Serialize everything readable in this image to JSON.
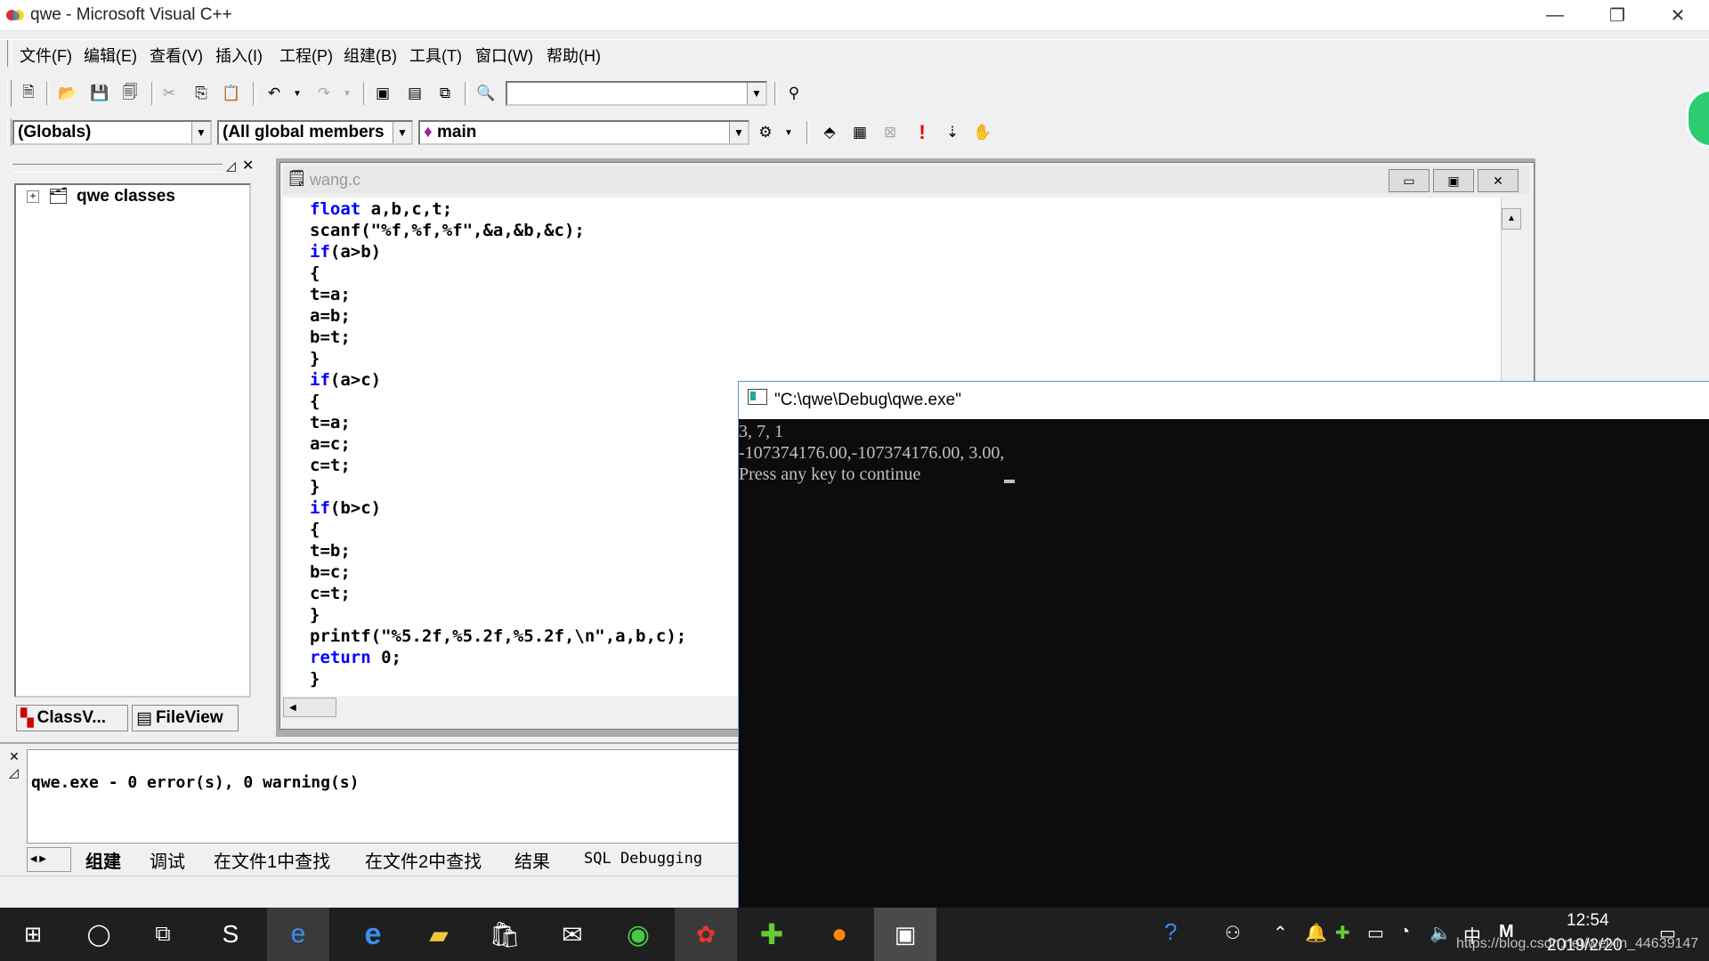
{
  "window": {
    "title": "qwe - Microsoft Visual C++"
  },
  "menu": {
    "items": [
      "文件(F)",
      "编辑(E)",
      "查看(V)",
      "插入(I)",
      "工程(P)",
      "组建(B)",
      "工具(T)",
      "窗口(W)",
      "帮助(H)"
    ]
  },
  "wizardbar": {
    "globals": "(Globals)",
    "members": "(All global members",
    "function": "main"
  },
  "workspace": {
    "tree_root": "qwe classes",
    "tab_classview": "ClassV...",
    "tab_fileview": "FileView"
  },
  "editor": {
    "filename": "wang.c",
    "lines": [
      {
        "kw": "float",
        "rest": " a,b,c,t;"
      },
      {
        "kw": "",
        "rest": "scanf(\"%f,%f,%f\",&a,&b,&c);"
      },
      {
        "kw": "if",
        "rest": "(a>b)"
      },
      {
        "kw": "",
        "rest": "{"
      },
      {
        "kw": "",
        "rest": "t=a;"
      },
      {
        "kw": "",
        "rest": "a=b;"
      },
      {
        "kw": "",
        "rest": "b=t;"
      },
      {
        "kw": "",
        "rest": "}"
      },
      {
        "kw": "if",
        "rest": "(a>c)"
      },
      {
        "kw": "",
        "rest": "{"
      },
      {
        "kw": "",
        "rest": "t=a;"
      },
      {
        "kw": "",
        "rest": "a=c;"
      },
      {
        "kw": "",
        "rest": "c=t;"
      },
      {
        "kw": "",
        "rest": "}"
      },
      {
        "kw": "if",
        "rest": "(b>c)"
      },
      {
        "kw": "",
        "rest": "{"
      },
      {
        "kw": "",
        "rest": "t=b;"
      },
      {
        "kw": "",
        "rest": "b=c;"
      },
      {
        "kw": "",
        "rest": "c=t;"
      },
      {
        "kw": "",
        "rest": "}"
      },
      {
        "kw": "",
        "rest": "printf(\"%5.2f,%5.2f,%5.2f,\\n\",a,b,c);"
      },
      {
        "kw": "return",
        "rest": " 0;"
      },
      {
        "kw": "",
        "rest": "}"
      }
    ]
  },
  "output": {
    "text": "qwe.exe - 0 error(s), 0 warning(s)",
    "tabs": [
      "组建",
      "调试",
      "在文件1中查找",
      "在文件2中查找",
      "结果",
      "SQL Debugging"
    ]
  },
  "console": {
    "title": "\"C:\\qwe\\Debug\\qwe.exe\"",
    "lines": [
      "3, 7, 1",
      "-107374176.00,-107374176.00, 3.00,",
      "Press any key to continue"
    ]
  },
  "taskbar": {
    "time": "12:54",
    "date": "2019/2/20",
    "ime": "中",
    "watermark": "https://blog.csdn.net/weixin_44639147"
  },
  "colors": {
    "keyword": "#0000ff",
    "console_bg": "#0c0c0c",
    "console_fg": "#c0c0c0",
    "taskbar_bg": "#1f1f1f"
  }
}
